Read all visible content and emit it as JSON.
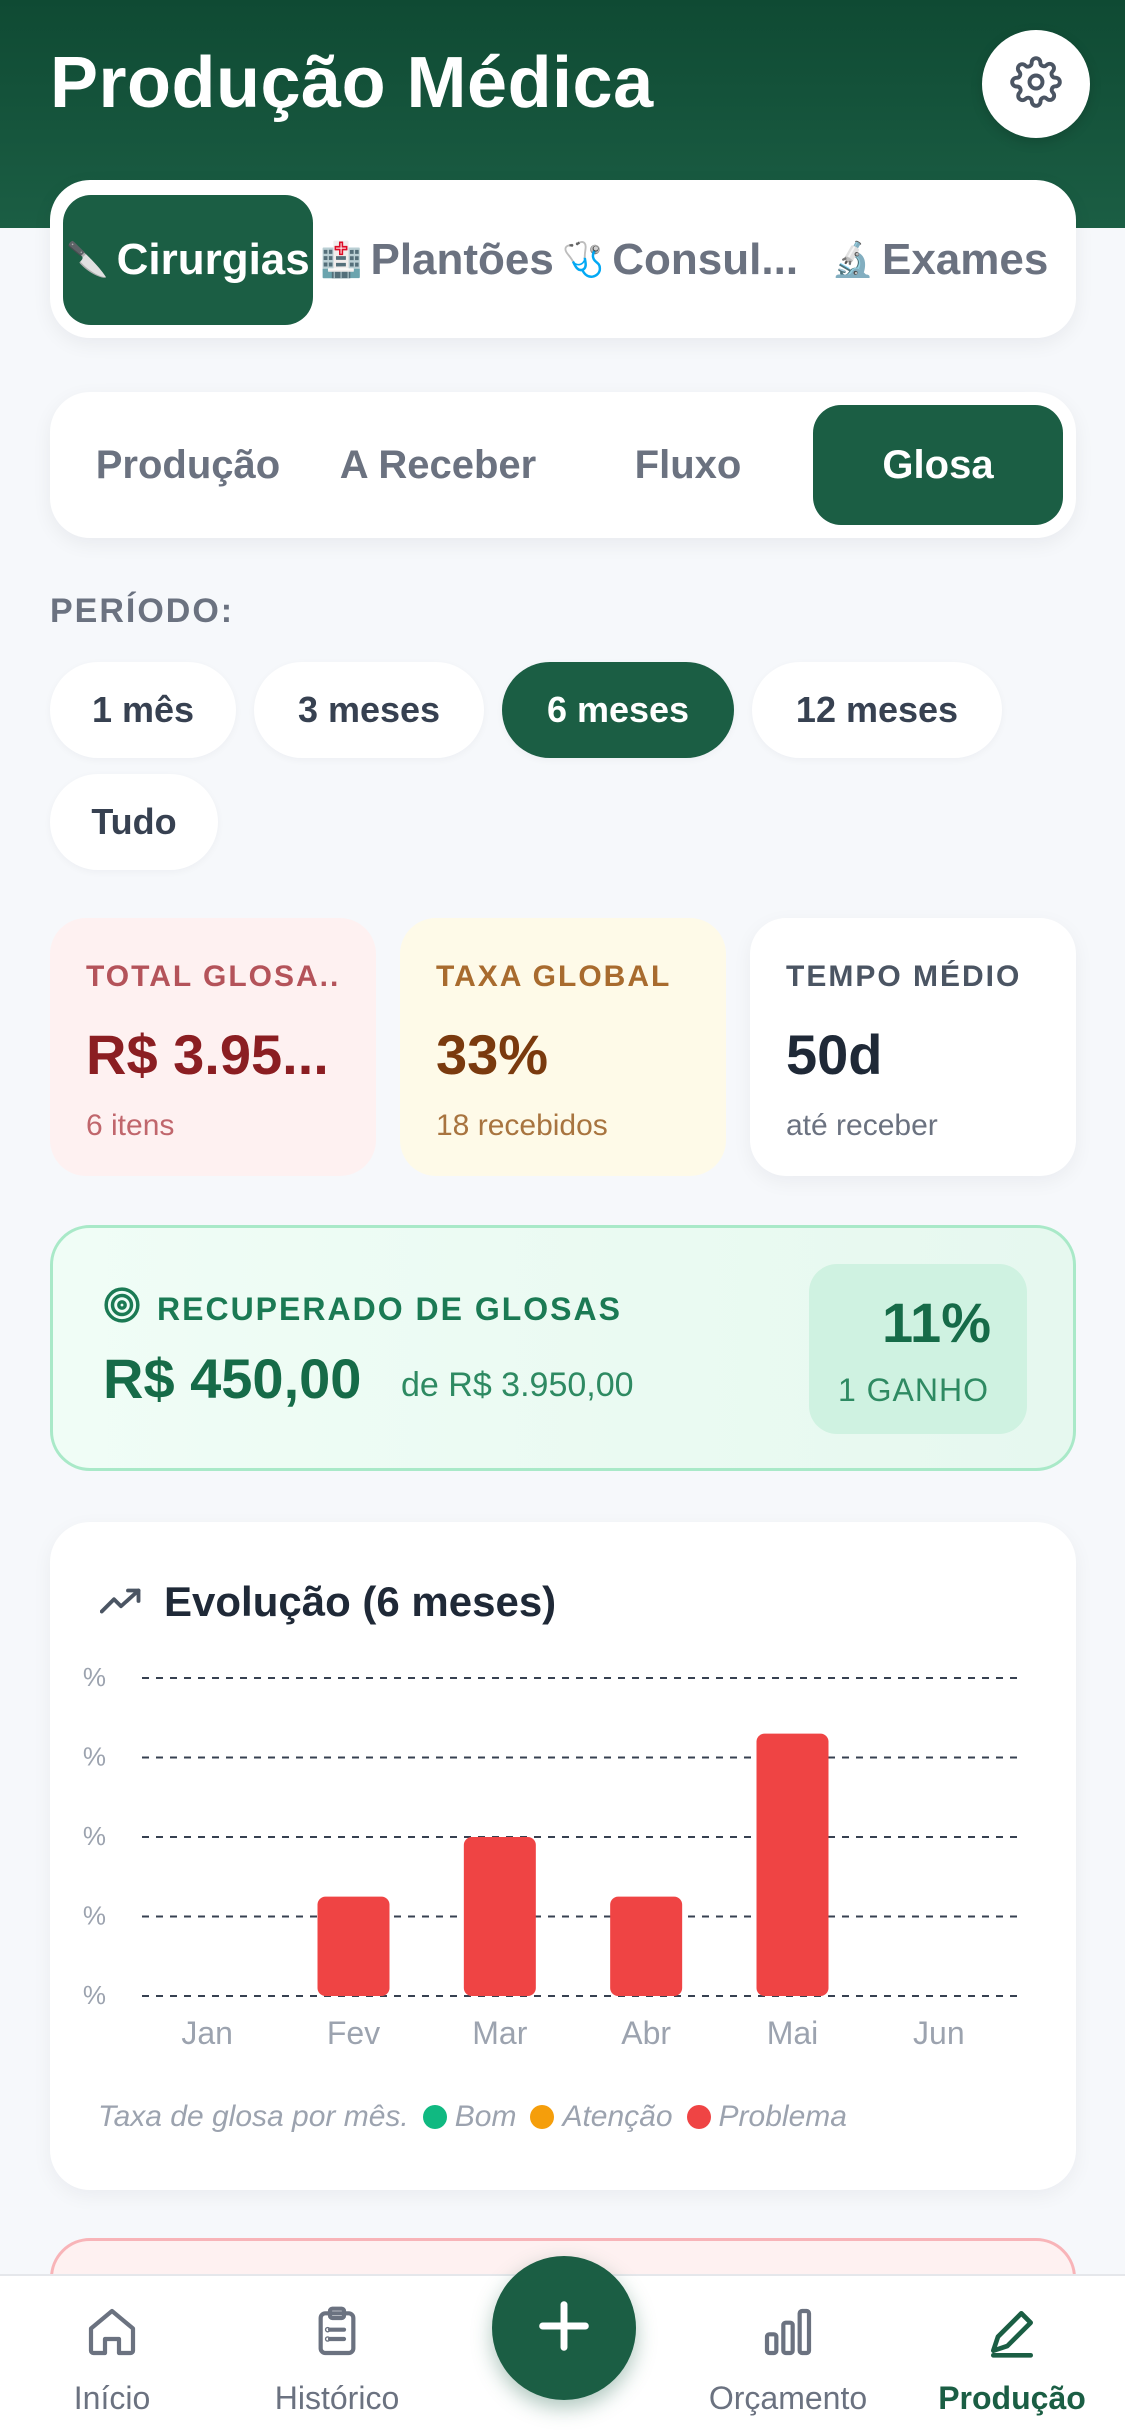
{
  "header": {
    "title": "Produção Médica",
    "settings_icon": "gear-icon"
  },
  "categories": [
    {
      "emoji": "🔪",
      "label": "Cirurgias",
      "active": true
    },
    {
      "emoji": "🏥",
      "label": "Plantões",
      "active": false
    },
    {
      "emoji": "🩺",
      "label": "Consul...",
      "active": false
    },
    {
      "emoji": "🔬",
      "label": "Exames",
      "active": false
    }
  ],
  "subtabs": [
    {
      "label": "Produção",
      "active": false
    },
    {
      "label": "A Receber",
      "active": false
    },
    {
      "label": "Fluxo",
      "active": false
    },
    {
      "label": "Glosa",
      "active": true
    }
  ],
  "period": {
    "label": "PERÍODO:",
    "options": [
      "1 mês",
      "3 meses",
      "6 meses",
      "12 meses",
      "Tudo"
    ],
    "selected": "6 meses"
  },
  "stats": [
    {
      "label": "TOTAL GLOSA...",
      "value": "R$ 3.95...",
      "sub": "6 itens"
    },
    {
      "label": "TAXA GLOBAL",
      "value": "33%",
      "sub": "18 recebidos"
    },
    {
      "label": "TEMPO MÉDIO",
      "value": "50d",
      "sub": "até receber"
    }
  ],
  "recovered": {
    "label": "RECUPERADO DE GLOSAS",
    "value": "R$ 450,00",
    "of": "de R$ 3.950,00",
    "percent": "11%",
    "count": "1 GANHO"
  },
  "chart": {
    "title": "Evolução (6 meses)",
    "legend_caption": "Taxa de glosa por mês.",
    "legend": [
      {
        "label": "Bom",
        "color": "#10B981"
      },
      {
        "label": "Atenção",
        "color": "#F59E0B"
      },
      {
        "label": "Problema",
        "color": "#EF4444"
      }
    ]
  },
  "chart_data": {
    "type": "bar",
    "categories": [
      "Jan",
      "Fev",
      "Mar",
      "Abr",
      "Mai",
      "Jun"
    ],
    "values": [
      0,
      1.25,
      2,
      1.25,
      3.3,
      0
    ],
    "y_tick_labels": [
      "%",
      "%",
      "%",
      "%",
      "%"
    ],
    "ylim": [
      0,
      4
    ],
    "bar_color": "#EF4444",
    "grid": true
  },
  "nav": [
    {
      "label": "Início",
      "icon": "home-icon",
      "active": false
    },
    {
      "label": "Histórico",
      "icon": "clipboard-icon",
      "active": false
    },
    {
      "label": "Orçamento",
      "icon": "bar-chart-icon",
      "active": false
    },
    {
      "label": "Produção",
      "icon": "pen-icon",
      "active": true
    }
  ]
}
